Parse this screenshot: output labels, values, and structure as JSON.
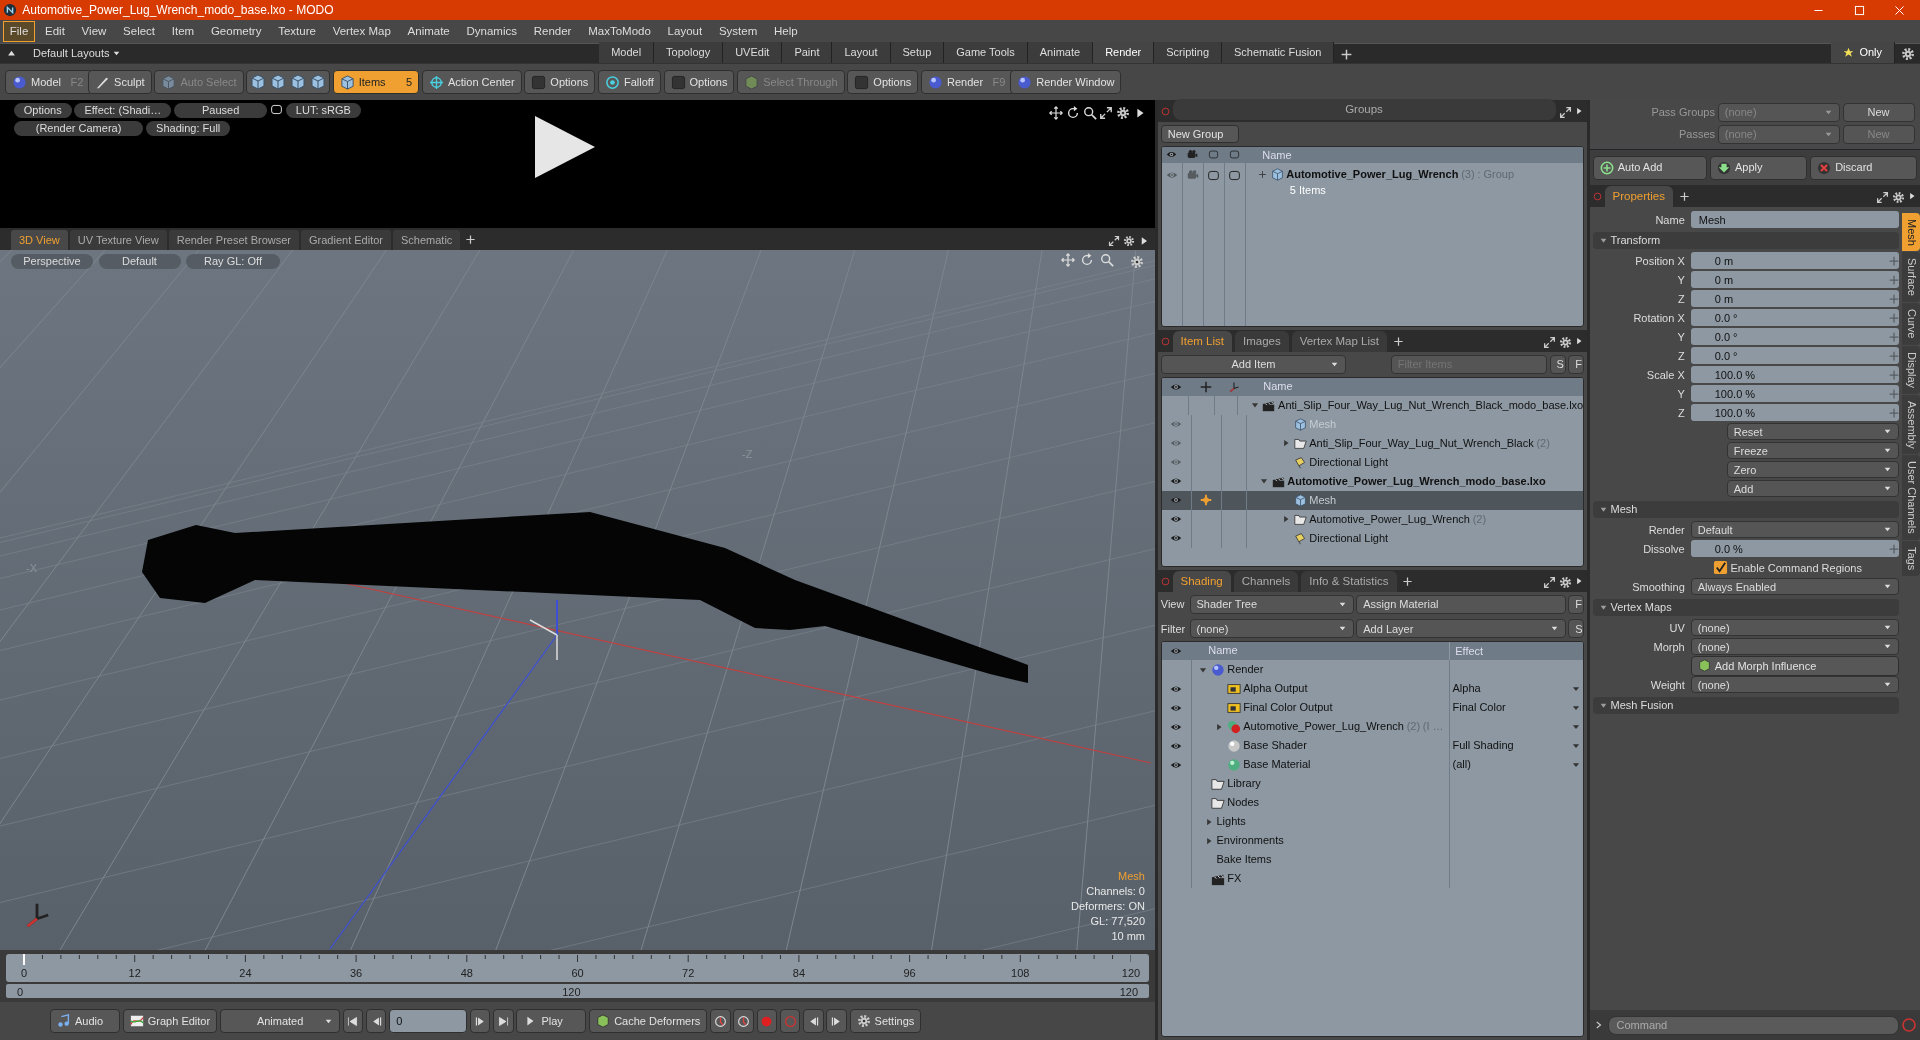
{
  "window": {
    "title": "Automotive_Power_Lug_Wrench_modo_base.lxo - MODO"
  },
  "menu": [
    {
      "label": "File",
      "selected": true
    },
    {
      "label": "Edit",
      "selected": false
    },
    {
      "label": "View",
      "selected": false
    },
    {
      "label": "Select",
      "selected": false
    },
    {
      "label": "Item",
      "selected": false
    },
    {
      "label": "Geometry",
      "selected": false
    },
    {
      "label": "Texture",
      "selected": false
    },
    {
      "label": "Vertex Map",
      "selected": false
    },
    {
      "label": "Animate",
      "selected": false
    },
    {
      "label": "Dynamics",
      "selected": false
    },
    {
      "label": "Render",
      "selected": false
    },
    {
      "label": "MaxToModo",
      "selected": false
    },
    {
      "label": "Layout",
      "selected": false
    },
    {
      "label": "System",
      "selected": false
    },
    {
      "label": "Help",
      "selected": false
    }
  ],
  "layout_bar": {
    "layouts": "Default Layouts",
    "only": "Only",
    "tabs": [
      {
        "label": "Model",
        "selected": false
      },
      {
        "label": "Topology",
        "selected": false
      },
      {
        "label": "UVEdit",
        "selected": false
      },
      {
        "label": "Paint",
        "selected": false
      },
      {
        "label": "Layout",
        "selected": false
      },
      {
        "label": "Setup",
        "selected": false
      },
      {
        "label": "Game Tools",
        "selected": false
      },
      {
        "label": "Animate",
        "selected": false
      },
      {
        "label": "Render",
        "selected": true
      },
      {
        "label": "Scripting",
        "selected": false
      },
      {
        "label": "Schematic Fusion",
        "selected": false
      }
    ]
  },
  "toolbar": [
    {
      "kind": "model",
      "label": "Model",
      "shortcut": "F2",
      "disabled": false,
      "on": false
    },
    {
      "kind": "sculpt",
      "label": "Sculpt",
      "disabled": false,
      "on": false
    },
    {
      "kind": "auto-select",
      "label": "Auto Select",
      "disabled": true,
      "on": false
    },
    {
      "kind": "modes"
    },
    {
      "kind": "items",
      "label": "Items",
      "count": "5",
      "disabled": false,
      "on": true
    },
    {
      "kind": "action-center",
      "label": "Action Center",
      "disabled": false,
      "on": false
    },
    {
      "kind": "options",
      "label": "Options",
      "disabled": false,
      "on": false
    },
    {
      "kind": "falloff",
      "label": "Falloff",
      "disabled": false,
      "on": false
    },
    {
      "kind": "options",
      "label": "Options",
      "disabled": false,
      "on": false
    },
    {
      "kind": "select-through",
      "label": "Select Through",
      "disabled": true,
      "on": false
    },
    {
      "kind": "options",
      "label": "Options",
      "disabled": false,
      "on": false
    },
    {
      "kind": "render",
      "label": "Render",
      "shortcut": "F9",
      "disabled": false,
      "on": false
    },
    {
      "kind": "render-window",
      "label": "Render Window",
      "disabled": false,
      "on": false
    }
  ],
  "preview": {
    "rows": [
      [
        "Options",
        "Effect: (Shadi…",
        "Paused",
        "LUT: sRGB"
      ],
      [
        "(Render Camera)",
        "Shading: Full"
      ]
    ]
  },
  "viewport": {
    "tabs": [
      {
        "label": "3D View",
        "selected": true
      },
      {
        "label": "UV Texture View",
        "selected": false
      },
      {
        "label": "Render Preset Browser",
        "selected": false
      },
      {
        "label": "Gradient Editor",
        "selected": false
      },
      {
        "label": "Schematic",
        "selected": false
      }
    ],
    "view_buttons": [
      "Perspective",
      "Default",
      "Ray GL: Off"
    ],
    "axis_labels": [
      "-Z",
      "-X"
    ],
    "info": [
      {
        "text": "Mesh",
        "highlight": true
      },
      {
        "text": "Channels: 0",
        "highlight": false
      },
      {
        "text": "Deformers: ON",
        "highlight": false
      },
      {
        "text": "GL: 77,520",
        "highlight": false
      },
      {
        "text": "10 mm",
        "highlight": false
      }
    ]
  },
  "timeline": {
    "ticks": [
      "0",
      "12",
      "24",
      "36",
      "48",
      "60",
      "72",
      "84",
      "96",
      "108",
      "120"
    ],
    "range": [
      "0",
      "120",
      "120"
    ],
    "level": 0
  },
  "transport": [
    {
      "kind": "audio",
      "label": "Audio"
    },
    {
      "kind": "graph",
      "label": "Graph Editor"
    },
    {
      "kind": "menu",
      "label": "Animated"
    },
    {
      "kind": "step-back"
    },
    {
      "kind": "field",
      "value": "0"
    },
    {
      "kind": "step-forward"
    },
    {
      "kind": "play",
      "label": "Play"
    },
    {
      "kind": "cache",
      "label": "Cache Deformers"
    },
    {
      "kind": "keys"
    },
    {
      "kind": "settings",
      "label": "Settings"
    }
  ],
  "groups": {
    "title": "Groups",
    "new_button": "New Group",
    "column": "Name",
    "rows": [
      {
        "name": "Automotive_Power_Lug_Wrench",
        "count": "(3)",
        "type": ": Group",
        "detail": "5 Items",
        "expanded": false
      }
    ]
  },
  "item_list": {
    "tabs": [
      {
        "label": "Item List",
        "selected": true
      },
      {
        "label": "Images",
        "selected": false
      },
      {
        "label": "Vertex Map List",
        "selected": false
      }
    ],
    "add_item": "Add Item",
    "filter": {
      "placeholder": "Filter Items"
    },
    "filter_buttons": [
      "S",
      "F"
    ],
    "column": "Name",
    "items": [
      {
        "kind": "scene",
        "name": "Anti_Slip_Four_Way_Lug_Nut_Wrench_Black_modo_base.lxo",
        "current": false,
        "expanded": true,
        "visible": false,
        "dimmed": false,
        "selected": false,
        "children": [
          {
            "kind": "mesh",
            "name": "Mesh",
            "visible": true,
            "dimmed": true,
            "selected": false
          },
          {
            "kind": "group",
            "name": "Anti_Slip_Four_Way_Lug_Nut_Wrench_Black",
            "count": "(2)",
            "expanded": false,
            "visible": true,
            "dimmed": false,
            "selected": false
          },
          {
            "kind": "light",
            "name": "Directional Light",
            "visible": true,
            "dimmed": false,
            "selected": false
          }
        ]
      },
      {
        "kind": "scene",
        "name": "Automotive_Power_Lug_Wrench_modo_base.lxo",
        "current": true,
        "expanded": true,
        "visible": true,
        "dimmed": false,
        "selected": false,
        "children": [
          {
            "kind": "mesh",
            "name": "Mesh",
            "visible": true,
            "dimmed": true,
            "selected": true
          },
          {
            "kind": "group",
            "name": "Automotive_Power_Lug_Wrench",
            "count": "(2)",
            "expanded": false,
            "visible": true,
            "dimmed": false,
            "selected": false
          },
          {
            "kind": "light",
            "name": "Directional Light",
            "visible": true,
            "dimmed": false,
            "selected": false
          }
        ]
      }
    ]
  },
  "shading": {
    "tabs": [
      {
        "label": "Shading",
        "selected": true
      },
      {
        "label": "Channels",
        "selected": false
      },
      {
        "label": "Info & Statistics",
        "selected": false
      }
    ],
    "view_label": "View",
    "view_value": "Shader Tree",
    "assign": "Assign Material",
    "filter_label": "Filter",
    "filter_value": "(none)",
    "add_layer": "Add Layer",
    "side_buttons": [
      "F",
      "S"
    ],
    "columns": [
      "Name",
      "Effect"
    ],
    "rows": [
      {
        "kind": "render",
        "name": "Render",
        "expanded": true,
        "visible": false,
        "children": [
          {
            "kind": "output",
            "name": "Alpha Output",
            "effect": "Alpha",
            "effect_menu": true,
            "visible": true
          },
          {
            "kind": "output",
            "name": "Final Color Output",
            "effect": "Final Color",
            "effect_menu": true,
            "visible": true
          },
          {
            "kind": "material-group",
            "name": "Automotive_Power_Lug_Wrench",
            "count": "(2)",
            "note": "(I …",
            "expanded": false,
            "effect_menu": true,
            "visible": true
          },
          {
            "kind": "shader",
            "name": "Base Shader",
            "effect": "Full Shading",
            "effect_menu": true,
            "visible": true
          },
          {
            "kind": "material",
            "name": "Base Material",
            "effect": "(all)",
            "effect_menu": true,
            "visible": true
          }
        ]
      },
      {
        "kind": "folder",
        "name": "Library",
        "visible": false
      },
      {
        "kind": "folder",
        "name": "Nodes",
        "visible": false
      },
      {
        "kind": "plain",
        "name": "Lights",
        "expanded": false,
        "visible": false
      },
      {
        "kind": "plain",
        "name": "Environments",
        "expanded": false,
        "visible": false
      },
      {
        "kind": "plain",
        "name": "Bake Items",
        "visible": false
      },
      {
        "kind": "fx",
        "name": "FX",
        "visible": false
      }
    ]
  },
  "passes": [
    {
      "label": "Pass Groups",
      "value": "(none)",
      "button": "New",
      "disabled": false
    },
    {
      "label": "Passes",
      "value": "(none)",
      "button": "New",
      "disabled": true
    }
  ],
  "actions": [
    {
      "kind": "auto-add",
      "label": "Auto Add"
    },
    {
      "kind": "apply",
      "label": "Apply"
    },
    {
      "kind": "discard",
      "label": "Discard"
    }
  ],
  "properties": {
    "tabs": [
      {
        "label": "Properties",
        "selected": true
      }
    ],
    "name_label": "Name",
    "name_value": "Mesh",
    "sections": [
      {
        "title": "Transform",
        "expanded": true,
        "rows": [
          {
            "kind": "number",
            "label": "Position X",
            "value": "0 m"
          },
          {
            "kind": "number",
            "label": "Y",
            "value": "0 m"
          },
          {
            "kind": "number",
            "label": "Z",
            "value": "0 m"
          },
          {
            "kind": "number",
            "label": "Rotation X",
            "value": "0.0 °"
          },
          {
            "kind": "number",
            "label": "Y",
            "value": "0.0 °"
          },
          {
            "kind": "number",
            "label": "Z",
            "value": "0.0 °"
          },
          {
            "kind": "number",
            "label": "Scale X",
            "value": "100.0 %"
          },
          {
            "kind": "number",
            "label": "Y",
            "value": "100.0 %"
          },
          {
            "kind": "number",
            "label": "Z",
            "value": "100.0 %"
          },
          {
            "kind": "menu",
            "value": "Reset"
          },
          {
            "kind": "menu",
            "value": "Freeze"
          },
          {
            "kind": "menu",
            "value": "Zero"
          },
          {
            "kind": "menu",
            "value": "Add"
          }
        ]
      },
      {
        "title": "Mesh",
        "expanded": true,
        "rows": [
          {
            "kind": "menu",
            "label": "Render",
            "value": "Default"
          },
          {
            "kind": "number",
            "label": "Dissolve",
            "value": "0.0 %"
          },
          {
            "kind": "check",
            "value": "Enable Command Regions",
            "checked": true
          },
          {
            "kind": "menu",
            "label": "Smoothing",
            "value": "Always Enabled"
          }
        ]
      },
      {
        "title": "Vertex Maps",
        "expanded": true,
        "rows": [
          {
            "kind": "menu",
            "label": "UV",
            "value": "(none)"
          },
          {
            "kind": "menu",
            "label": "Morph",
            "value": "(none)"
          },
          {
            "kind": "button",
            "value": "Add Morph Influence"
          },
          {
            "kind": "menu",
            "label": "Weight",
            "value": "(none)"
          }
        ]
      },
      {
        "title": "Mesh Fusion",
        "expanded": true
      }
    ],
    "side_tabs": [
      {
        "label": "Mesh",
        "selected": true
      },
      {
        "label": "Surface",
        "selected": false
      },
      {
        "label": "Curve",
        "selected": false
      },
      {
        "label": "Display",
        "selected": false
      },
      {
        "label": "Assembly",
        "selected": false
      },
      {
        "label": "User Channels",
        "selected": false
      },
      {
        "label": "Tags",
        "selected": false
      }
    ]
  },
  "command": {
    "placeholder": "Command"
  }
}
